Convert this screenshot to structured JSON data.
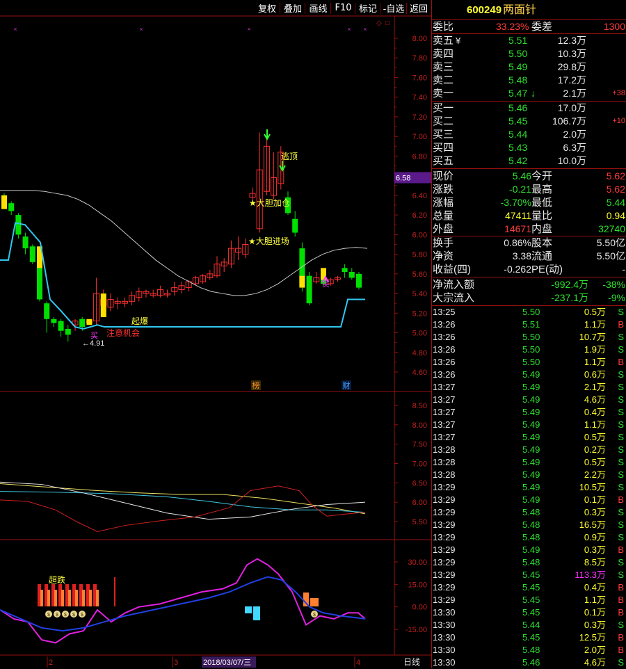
{
  "toolbar": {
    "buttons": [
      "复权",
      "叠加",
      "画线",
      "F10",
      "标记",
      "-自选",
      "返回"
    ]
  },
  "chart": {
    "price_axis": [
      "8.00",
      "7.80",
      "7.60",
      "7.40",
      "7.20",
      "7.00",
      "6.80",
      "6.60",
      "6.40",
      "6.20",
      "6.00",
      "5.80",
      "5.60",
      "5.40",
      "5.20",
      "5.00",
      "4.80",
      "4.60"
    ],
    "price_marker": "6.58",
    "mid_axis": [
      "8.50",
      "8.00",
      "7.50",
      "7.00",
      "6.50",
      "6.00",
      "5.50"
    ],
    "low_axis": [
      "30.00",
      "15.00",
      "0.00",
      "-15.00"
    ],
    "annotations": {
      "escape_top": "逃顶",
      "bold_add": "★大胆加仓",
      "bold_enter": "★大胆进场",
      "takeoff": "起爆",
      "attention": "注意机会",
      "low_price": "←4.91",
      "buy1": "买",
      "buy2": "买",
      "rank_badge": "榜",
      "fin_badge": "财",
      "super_drop": "超跌",
      "coin_glyph": "$"
    },
    "date_bar": {
      "mark1": "2",
      "mark2": "3",
      "current_date": "2018/03/07/三",
      "mark3": "4",
      "period": "日线"
    },
    "colors": {
      "up": "#ff3030",
      "down": "#00e000",
      "cyan": "#30c8f0",
      "frame": "#9a1010"
    }
  },
  "quote": {
    "code": "600249",
    "name": "两面针",
    "wei_bi_label": "委比",
    "wei_bi": "33.23%",
    "wei_cha_label": "委差",
    "wei_cha": "1300",
    "sells": [
      {
        "label": "卖五",
        "flag": "¥",
        "price": "5.51",
        "vol": "12.3万",
        "extra": ""
      },
      {
        "label": "卖四",
        "flag": "",
        "price": "5.50",
        "vol": "10.3万",
        "extra": ""
      },
      {
        "label": "卖三",
        "flag": "",
        "price": "5.49",
        "vol": "29.8万",
        "extra": ""
      },
      {
        "label": "卖二",
        "flag": "",
        "price": "5.48",
        "vol": "17.2万",
        "extra": ""
      },
      {
        "label": "卖一",
        "flag": "",
        "price": "5.47",
        "vol": "2.1万",
        "extra": "+38",
        "arrow": "↓"
      }
    ],
    "buys": [
      {
        "label": "买一",
        "price": "5.46",
        "vol": "17.0万",
        "extra": ""
      },
      {
        "label": "买二",
        "price": "5.45",
        "vol": "106.7万",
        "extra": "+10"
      },
      {
        "label": "买三",
        "price": "5.44",
        "vol": "2.0万",
        "extra": ""
      },
      {
        "label": "买四",
        "price": "5.43",
        "vol": "6.3万",
        "extra": ""
      },
      {
        "label": "买五",
        "price": "5.42",
        "vol": "10.0万",
        "extra": ""
      }
    ],
    "stats": [
      {
        "l1": "现价",
        "v1": "5.46",
        "c1": "green",
        "l2": "今开",
        "v2": "5.62",
        "c2": "red"
      },
      {
        "l1": "涨跌",
        "v1": "-0.21",
        "c1": "green",
        "l2": "最高",
        "v2": "5.62",
        "c2": "red"
      },
      {
        "l1": "涨幅",
        "v1": "-3.70%",
        "c1": "green",
        "l2": "最低",
        "v2": "5.44",
        "c2": "green"
      },
      {
        "l1": "总量",
        "v1": "47411",
        "c1": "yellow",
        "l2": "量比",
        "v2": "0.94",
        "c2": "yellow"
      },
      {
        "l1": "外盘",
        "v1": "14671",
        "c1": "red",
        "l2": "内盘",
        "v2": "32740",
        "c2": "green"
      }
    ],
    "stats2": [
      {
        "l1": "换手",
        "v1": "0.86%",
        "l2": "股本",
        "v2": "5.50亿"
      },
      {
        "l1": "净资",
        "v1": "3.38",
        "l2": "流通",
        "v2": "5.50亿"
      },
      {
        "l1": "收益(四)",
        "v1": "-0.262",
        "l2": "PE(动)",
        "v2": "-"
      }
    ],
    "flows": [
      {
        "label": "净流入额",
        "value": "-992.4万",
        "pct": "-38%"
      },
      {
        "label": "大宗流入",
        "value": "-237.1万",
        "pct": "-9%"
      }
    ],
    "ticks": [
      {
        "t": "13:25",
        "p": "5.50",
        "pc": "green",
        "v": "0.5万",
        "vc": "yellow",
        "s": "S"
      },
      {
        "t": "13:26",
        "p": "5.51",
        "pc": "green",
        "v": "1.1万",
        "vc": "yellow",
        "s": "B"
      },
      {
        "t": "13:26",
        "p": "5.50",
        "pc": "green",
        "v": "10.7万",
        "vc": "yellow",
        "s": "S"
      },
      {
        "t": "13:26",
        "p": "5.50",
        "pc": "green",
        "v": "1.9万",
        "vc": "yellow",
        "s": "S"
      },
      {
        "t": "13:26",
        "p": "5.50",
        "pc": "green",
        "v": "1.1万",
        "vc": "yellow",
        "s": "B"
      },
      {
        "t": "13:26",
        "p": "5.49",
        "pc": "green",
        "v": "0.6万",
        "vc": "yellow",
        "s": "S"
      },
      {
        "t": "13:27",
        "p": "5.49",
        "pc": "green",
        "v": "2.1万",
        "vc": "yellow",
        "s": "S"
      },
      {
        "t": "13:27",
        "p": "5.49",
        "pc": "green",
        "v": "4.6万",
        "vc": "yellow",
        "s": "S"
      },
      {
        "t": "13:27",
        "p": "5.49",
        "pc": "green",
        "v": "0.4万",
        "vc": "yellow",
        "s": "S"
      },
      {
        "t": "13:27",
        "p": "5.49",
        "pc": "green",
        "v": "1.1万",
        "vc": "yellow",
        "s": "S"
      },
      {
        "t": "13:27",
        "p": "5.49",
        "pc": "green",
        "v": "0.5万",
        "vc": "yellow",
        "s": "S"
      },
      {
        "t": "13:28",
        "p": "5.49",
        "pc": "green",
        "v": "0.2万",
        "vc": "yellow",
        "s": "S"
      },
      {
        "t": "13:28",
        "p": "5.49",
        "pc": "green",
        "v": "0.5万",
        "vc": "yellow",
        "s": "S"
      },
      {
        "t": "13:28",
        "p": "5.49",
        "pc": "green",
        "v": "2.2万",
        "vc": "yellow",
        "s": "S"
      },
      {
        "t": "13:29",
        "p": "5.49",
        "pc": "green",
        "v": "10.5万",
        "vc": "yellow",
        "s": "S"
      },
      {
        "t": "13:29",
        "p": "5.49",
        "pc": "green",
        "v": "0.1万",
        "vc": "yellow",
        "s": "B"
      },
      {
        "t": "13:29",
        "p": "5.48",
        "pc": "green",
        "v": "0.3万",
        "vc": "yellow",
        "s": "S"
      },
      {
        "t": "13:29",
        "p": "5.48",
        "pc": "green",
        "v": "16.5万",
        "vc": "yellow",
        "s": "S"
      },
      {
        "t": "13:29",
        "p": "5.48",
        "pc": "green",
        "v": "0.9万",
        "vc": "yellow",
        "s": "S"
      },
      {
        "t": "13:29",
        "p": "5.49",
        "pc": "green",
        "v": "0.3万",
        "vc": "yellow",
        "s": "B"
      },
      {
        "t": "13:29",
        "p": "5.48",
        "pc": "green",
        "v": "8.5万",
        "vc": "yellow",
        "s": "S"
      },
      {
        "t": "13:29",
        "p": "5.45",
        "pc": "green",
        "v": "113.3万",
        "vc": "magenta",
        "s": "S"
      },
      {
        "t": "13:29",
        "p": "5.45",
        "pc": "green",
        "v": "0.4万",
        "vc": "yellow",
        "s": "B"
      },
      {
        "t": "13:29",
        "p": "5.45",
        "pc": "green",
        "v": "1.1万",
        "vc": "yellow",
        "s": "B"
      },
      {
        "t": "13:30",
        "p": "5.45",
        "pc": "green",
        "v": "0.1万",
        "vc": "yellow",
        "s": "B"
      },
      {
        "t": "13:30",
        "p": "5.44",
        "pc": "green",
        "v": "0.3万",
        "vc": "yellow",
        "s": "S"
      },
      {
        "t": "13:30",
        "p": "5.45",
        "pc": "green",
        "v": "12.5万",
        "vc": "yellow",
        "s": "B"
      },
      {
        "t": "13:30",
        "p": "5.48",
        "pc": "green",
        "v": "2.0万",
        "vc": "yellow",
        "s": "B"
      },
      {
        "t": "13:30",
        "p": "5.46",
        "pc": "green",
        "v": "4.6万",
        "vc": "yellow",
        "s": "S"
      }
    ]
  },
  "chart_data": {
    "type": "candlestick",
    "title": "",
    "ylim": [
      4.5,
      8.1
    ],
    "candles": [
      [
        6.38,
        6.3,
        6.42,
        6.26,
        "down"
      ],
      [
        6.32,
        6.24,
        6.34,
        6.2,
        "down"
      ],
      [
        6.2,
        6.0,
        6.22,
        5.96,
        "down"
      ],
      [
        5.98,
        5.86,
        6.02,
        5.8,
        "down"
      ],
      [
        5.88,
        5.72,
        5.9,
        5.7,
        "down"
      ],
      [
        5.72,
        5.34,
        5.74,
        5.32,
        "down"
      ],
      [
        5.3,
        5.14,
        5.32,
        5.0,
        "down"
      ],
      [
        5.14,
        5.1,
        5.16,
        5.06,
        "down"
      ],
      [
        5.12,
        5.02,
        5.14,
        4.96,
        "down"
      ],
      [
        5.04,
        4.98,
        5.08,
        4.91,
        "down"
      ],
      [
        5.08,
        5.12,
        5.14,
        5.02,
        "up"
      ],
      [
        5.14,
        5.06,
        5.16,
        5.02,
        "down"
      ],
      [
        5.12,
        5.12,
        5.14,
        5.08,
        "up"
      ],
      [
        5.12,
        5.4,
        5.56,
        5.08,
        "up"
      ],
      [
        5.34,
        5.28,
        5.44,
        5.2,
        "up"
      ],
      [
        5.26,
        5.34,
        5.4,
        5.22,
        "up"
      ],
      [
        5.32,
        5.3,
        5.36,
        5.24,
        "up"
      ],
      [
        5.3,
        5.32,
        5.36,
        5.26,
        "up"
      ],
      [
        5.32,
        5.38,
        5.42,
        5.28,
        "up"
      ],
      [
        5.36,
        5.42,
        5.46,
        5.32,
        "up"
      ],
      [
        5.4,
        5.42,
        5.44,
        5.36,
        "up"
      ],
      [
        5.4,
        5.38,
        5.44,
        5.36,
        "up"
      ],
      [
        5.38,
        5.44,
        5.48,
        5.36,
        "up"
      ],
      [
        5.4,
        5.4,
        5.44,
        5.36,
        "up"
      ],
      [
        5.42,
        5.46,
        5.52,
        5.38,
        "up"
      ],
      [
        5.44,
        5.48,
        5.52,
        5.4,
        "up"
      ],
      [
        5.46,
        5.52,
        5.54,
        5.42,
        "up"
      ],
      [
        5.5,
        5.56,
        5.58,
        5.48,
        "up"
      ],
      [
        5.52,
        5.58,
        5.6,
        5.5,
        "up"
      ],
      [
        5.56,
        5.6,
        5.64,
        5.54,
        "up"
      ],
      [
        5.58,
        5.7,
        5.78,
        5.56,
        "up"
      ],
      [
        5.68,
        5.72,
        5.76,
        5.62,
        "up"
      ],
      [
        5.7,
        5.86,
        5.94,
        5.66,
        "up"
      ],
      [
        5.82,
        5.86,
        5.98,
        5.74,
        "up"
      ],
      [
        5.8,
        5.9,
        5.96,
        5.76,
        "up"
      ],
      [
        6.38,
        6.42,
        6.48,
        6.32,
        "up"
      ],
      [
        6.06,
        6.66,
        7.04,
        6.02,
        "up"
      ],
      [
        6.44,
        6.9,
        7.02,
        6.4,
        "up"
      ],
      [
        6.4,
        6.58,
        6.84,
        6.36,
        "up"
      ],
      [
        6.52,
        6.84,
        6.9,
        6.46,
        "up"
      ],
      [
        6.38,
        6.22,
        6.44,
        6.2,
        "down"
      ],
      [
        6.16,
        6.02,
        6.24,
        5.98,
        "down"
      ],
      [
        5.86,
        5.48,
        5.92,
        5.42,
        "down"
      ],
      [
        5.58,
        5.3,
        5.62,
        5.28,
        "down"
      ],
      [
        5.52,
        5.56,
        5.62,
        5.5,
        "up"
      ],
      [
        5.58,
        5.5,
        5.64,
        5.48,
        "down"
      ],
      [
        5.5,
        5.54,
        5.56,
        5.48,
        "up"
      ],
      [
        5.56,
        5.56,
        5.58,
        5.52,
        "up"
      ],
      [
        5.66,
        5.62,
        5.7,
        5.56,
        "down"
      ],
      [
        5.62,
        5.56,
        5.66,
        5.54,
        "down"
      ],
      [
        5.6,
        5.46,
        5.62,
        5.44,
        "down"
      ]
    ]
  }
}
